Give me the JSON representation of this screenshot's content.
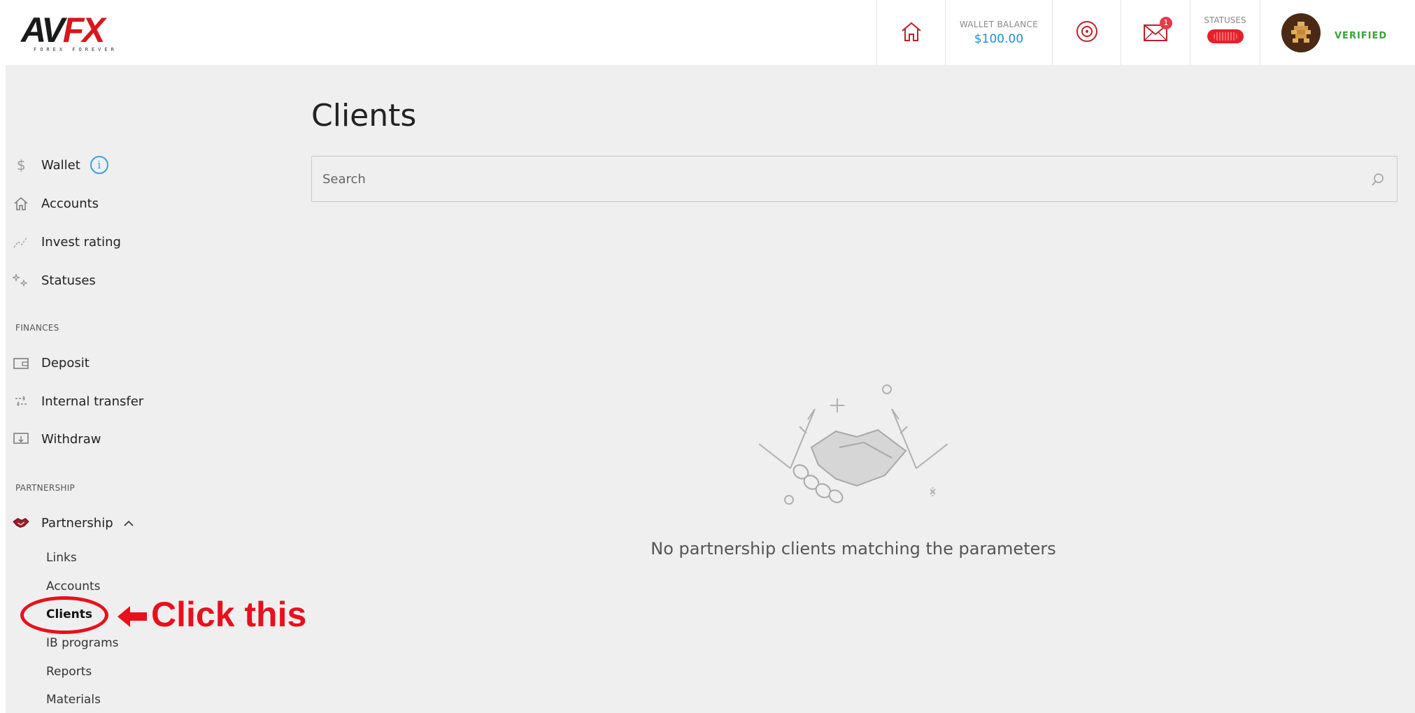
{
  "brand": {
    "logo_main_dark": "AV",
    "logo_main_red": "FX",
    "logo_sub": "FOREX FOREVER"
  },
  "header": {
    "wallet_label": "WALLET BALANCE",
    "wallet_value": "$100.00",
    "mail_count": "1",
    "statuses_label": "STATUSES",
    "verified_label": "VERIFIED"
  },
  "sidebar": {
    "items": [
      {
        "label": "Wallet",
        "icon": "dollar-icon"
      },
      {
        "label": "Accounts",
        "icon": "home-icon"
      },
      {
        "label": "Invest rating",
        "icon": "chart-line-icon"
      },
      {
        "label": "Statuses",
        "icon": "sparkle-icon"
      }
    ],
    "finances_heading": "FINANCES",
    "finances": [
      {
        "label": "Deposit",
        "icon": "wallet-icon"
      },
      {
        "label": "Internal transfer",
        "icon": "transfer-icon"
      },
      {
        "label": "Withdraw",
        "icon": "withdraw-icon"
      }
    ],
    "partnership_heading": "PARTNERSHIP",
    "partnership_label": "Partnership",
    "partnership_sub": [
      "Links",
      "Accounts",
      "Clients",
      "IB programs",
      "Reports",
      "Materials"
    ]
  },
  "annotation": {
    "text": "Click this",
    "color": "#e8101d"
  },
  "main": {
    "title": "Clients",
    "search_placeholder": "Search",
    "empty_message": "No partnership clients matching the parameters"
  },
  "colors": {
    "accent": "#1a8fd6",
    "brand_red": "#d9161c",
    "verified": "#3aa23a"
  }
}
